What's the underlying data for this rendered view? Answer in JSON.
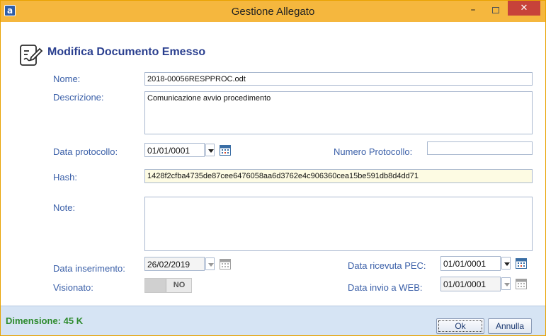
{
  "window": {
    "title": "Gestione Allegato",
    "app_icon": "a"
  },
  "header": {
    "title": "Modifica Documento Emesso",
    "icon": "edit-document-icon"
  },
  "form": {
    "nome_label": "Nome:",
    "nome_value": "2018-00056RESPPROC.odt",
    "descrizione_label": "Descrizione:",
    "descrizione_value": "Comunicazione avvio procedimento",
    "data_protocollo_label": "Data protocollo:",
    "data_protocollo_value": "01/01/0001",
    "numero_protocollo_label": "Numero Protocollo:",
    "numero_protocollo_value": "",
    "hash_label": "Hash:",
    "hash_value": "1428f2cfba4735de87cee6476058aa6d3762e4c906360cea15be591db8d4dd71",
    "note_label": "Note:",
    "note_value": "",
    "data_inserimento_label": "Data inserimento:",
    "data_inserimento_value": "26/02/2019",
    "visionato_label": "Visionato:",
    "visionato_value": "NO",
    "data_ricevuta_pec_label": "Data ricevuta PEC:",
    "data_ricevuta_pec_value": "01/01/0001",
    "data_invio_web_label": "Data invio a WEB:",
    "data_invio_web_value": "01/01/0001"
  },
  "status": {
    "dimensione": "Dimensione: 45 K"
  },
  "buttons": {
    "ok": "Ok",
    "cancel": "Annulla"
  },
  "colors": {
    "titlebar": "#f5b73e",
    "close": "#c7423a",
    "label": "#3a5fa8",
    "status_text": "#2e8b2e",
    "statusbar": "#d6e4f4"
  }
}
